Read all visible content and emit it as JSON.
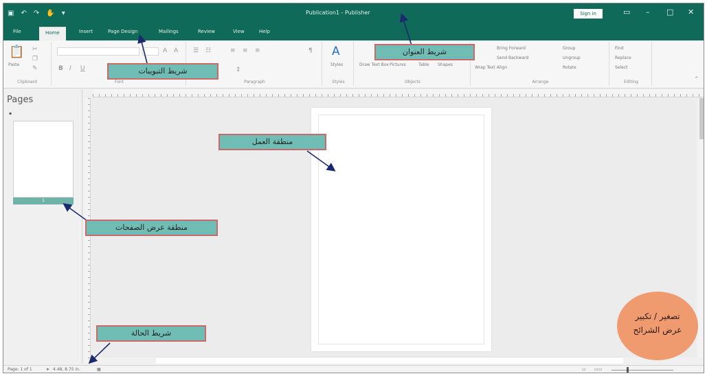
{
  "window": {
    "title": "Publication1 - Publisher",
    "sign_in": "Sign in"
  },
  "tabs": [
    "File",
    "Home",
    "Insert",
    "Page Design",
    "Mailings",
    "Review",
    "View",
    "Help"
  ],
  "active_tab": "Home",
  "ribbon": {
    "groups": [
      "Clipboard",
      "Font",
      "Paragraph",
      "Styles",
      "Objects",
      "Arrange",
      "Editing"
    ],
    "paste_label": "Paste",
    "styles_label": "Styles",
    "draw_text_box": "Draw Text Box",
    "pictures": "Pictures",
    "table": "Table",
    "shapes": "Shapes",
    "wrap_text": "Wrap Text",
    "bring_forward": "Bring Forward",
    "send_backward": "Send Backward",
    "align": "Align",
    "group": "Group",
    "ungroup": "Ungroup",
    "rotate": "Rotate",
    "find": "Find",
    "replace": "Replace",
    "select": "Select"
  },
  "pages_pane": {
    "title": "Pages",
    "thumb_label": "1"
  },
  "status_bar": {
    "page": "Page: 1 of 1",
    "position": "4.48, 8.75 in."
  },
  "callouts": {
    "title_bar": "شريط العنوان",
    "tabs_bar": "شريط التبويبات",
    "work_area": "منطقة العمل",
    "pages_area": "منطقة عرض الصفحات",
    "status_bar": "شريط الحالة",
    "zoom": [
      "تصغير / تكبير",
      "عرض الشرائح"
    ]
  },
  "colors": {
    "titlebar": "#0f6a59",
    "callout_fill": "#6fbdb5",
    "callout_border": "#c86a6a",
    "zoom_bubble": "#f09a70"
  }
}
